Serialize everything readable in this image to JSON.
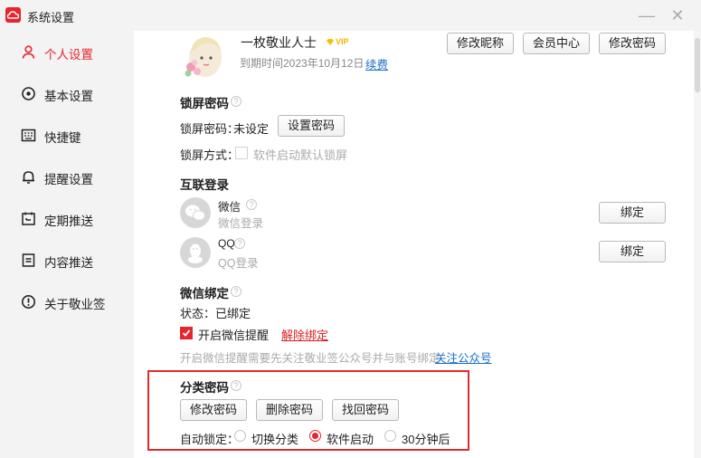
{
  "window": {
    "title": "系统设置",
    "minimize_glyph": "—",
    "close_glyph": "✕"
  },
  "sidebar": {
    "items": [
      {
        "label": "个人设置",
        "icon": "user-icon",
        "active": true
      },
      {
        "label": "基本设置",
        "icon": "settings-icon",
        "active": false
      },
      {
        "label": "快捷键",
        "icon": "keyboard-icon",
        "active": false
      },
      {
        "label": "提醒设置",
        "icon": "bell-icon",
        "active": false
      },
      {
        "label": "定期推送",
        "icon": "calendar-icon",
        "active": false
      },
      {
        "label": "内容推送",
        "icon": "document-icon",
        "active": false
      },
      {
        "label": "关于敬业签",
        "icon": "info-icon",
        "active": false
      }
    ]
  },
  "profile": {
    "username": "一枚敬业人士",
    "vip_badge": "VIP",
    "expiry": "到期时间2023年10月12日",
    "renew_link": "续费",
    "buttons": {
      "edit_nickname": "修改昵称",
      "member_center": "会员中心",
      "change_password": "修改密码"
    }
  },
  "lock_screen": {
    "title": "锁屏密码",
    "help": "?",
    "password_label": "锁屏密码：",
    "password_status": "未设定",
    "set_button": "设置密码",
    "mode_label": "锁屏方式：",
    "mode_option": "软件启动默认锁屏",
    "mode_checked": false
  },
  "linked_login": {
    "title": "互联登录",
    "accounts": [
      {
        "name": "微信",
        "help": "?",
        "sub": "微信登录",
        "button": "绑定",
        "icon": "wechat-icon"
      },
      {
        "name": "QQ",
        "help": "?",
        "sub": "QQ登录",
        "button": "绑定",
        "icon": "qq-icon"
      }
    ]
  },
  "wechat_bind": {
    "title": "微信绑定",
    "help": "?",
    "status": "状态：已绑定",
    "reminder_label": "开启微信提醒",
    "reminder_checked": true,
    "unbind_link": "解除绑定",
    "note": "开启微信提醒需要先关注敬业签公众号并与账号绑定",
    "follow_link": "关注公众号"
  },
  "category_password": {
    "title": "分类密码",
    "help": "?",
    "buttons": {
      "modify": "修改密码",
      "delete": "删除密码",
      "recover": "找回密码"
    },
    "auto_lock_label": "自动锁定：",
    "options": [
      {
        "label": "切换分类",
        "selected": false
      },
      {
        "label": "软件启动",
        "selected": true
      },
      {
        "label": "30分钟后",
        "selected": false
      }
    ]
  },
  "colors": {
    "accent": "#e8242d",
    "link": "#1a6fc9",
    "sidebar_bg": "#f3f3f3",
    "highlight_frame": "#e32b2b"
  }
}
